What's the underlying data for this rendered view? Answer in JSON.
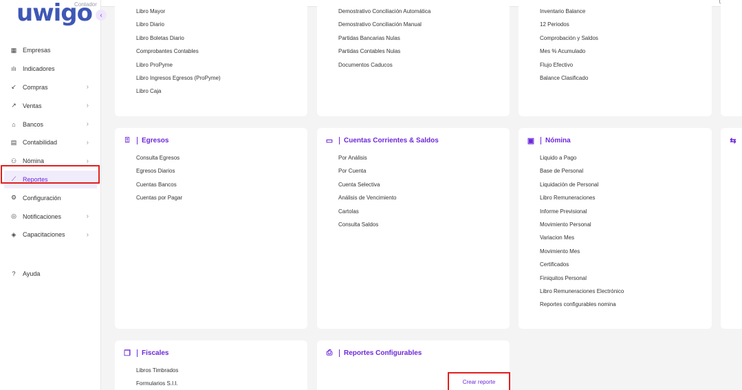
{
  "logo": {
    "text": "uwigo",
    "tag": "Contador"
  },
  "nav": {
    "items": [
      {
        "label": "Empresas",
        "icon": "building-icon"
      },
      {
        "label": "Indicadores",
        "icon": "bar-chart-icon"
      },
      {
        "label": "Compras",
        "icon": "arrow-down-left-icon"
      },
      {
        "label": "Ventas",
        "icon": "arrow-up-right-icon"
      },
      {
        "label": "Bancos",
        "icon": "bank-icon"
      },
      {
        "label": "Contabilidad",
        "icon": "calculator-icon"
      },
      {
        "label": "Nómina",
        "icon": "users-icon"
      },
      {
        "label": "Reportes",
        "icon": "line-chart-icon"
      },
      {
        "label": "Configuración",
        "icon": "gear-icon"
      },
      {
        "label": "Notificaciones",
        "icon": "bell-icon"
      },
      {
        "label": "Capacitaciones",
        "icon": "graduation-cap-icon"
      }
    ],
    "help": "Ayuda"
  },
  "top_cards": [
    {
      "links": [
        "Libro Mayor",
        "Libro Diario",
        "Libro Boletas Diario",
        "Comprobantes Contables",
        "Libro ProPyme",
        "Libro Ingresos Egresos (ProPyme)",
        "Libro Caja"
      ]
    },
    {
      "links": [
        "Demostrativo Conciliación Automática",
        "Demostrativo Conciliación Manual",
        "Partidas Bancarias Nulas",
        "Partidas Contables Nulas",
        "Documentos Caducos"
      ]
    },
    {
      "links": [
        "Inventario Balance",
        "12 Periodos",
        "Comprobación y Saldos",
        "Mes % Acumulado",
        "Flujo Efectivo",
        "Balance Clasificado"
      ]
    }
  ],
  "egresos": {
    "title": "Egresos",
    "links": [
      "Consulta Egresos",
      "Egresos Diarios",
      "Cuentas Bancos",
      "Cuentas por Pagar"
    ]
  },
  "cuentas": {
    "title": "Cuentas Corrientes & Saldos",
    "links": [
      "Por Análisis",
      "Por Cuenta",
      "Cuenta Selectiva",
      "Análisis de Vencimiento",
      "Cartolas",
      "Consulta Saldos"
    ]
  },
  "nomina": {
    "title": "Nómina",
    "links": [
      "Liquido a Pago",
      "Base de Personal",
      "Liquidación de Personal",
      "Libro Remuneraciones",
      "Informe Previsional",
      "Movimiento Personal",
      "Variacion Mes",
      "Movimiento Mes",
      "Certificados",
      "Finiquitos Personal",
      "Libro Remuneraciones Electrónico",
      "Reportes configurables nomina"
    ]
  },
  "fiscales": {
    "title": "Fiscales",
    "links": [
      "Libros Timbrados",
      "Formularios S.I.I."
    ]
  },
  "configurables": {
    "title": "Reportes Configurables",
    "create": "Crear reporte"
  },
  "colors": {
    "accent": "#6d28d9",
    "highlight": "#e01e1e"
  }
}
